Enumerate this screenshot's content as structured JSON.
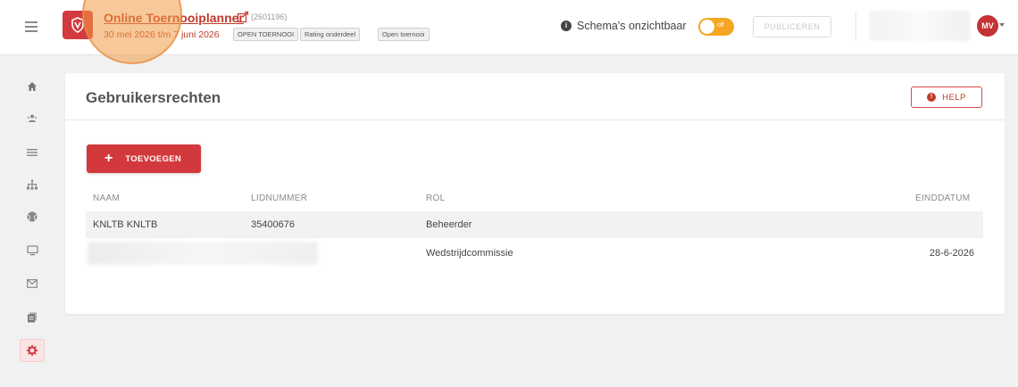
{
  "header": {
    "title": "Online Toernooiplanner",
    "tournament_id": "(2601196)",
    "dates": "30 mei 2026 t/m 7 juni 2026",
    "badges": [
      "OPEN TOERNOOI",
      "Rating onderdeel",
      "Open toernooi"
    ],
    "schema_label": "Schema's onzichtbaar",
    "toggle_text": "off",
    "publish_label": "PUBLICEREN",
    "avatar_initials": "MV"
  },
  "sidebar": {
    "items": [
      {
        "icon": "home-icon"
      },
      {
        "icon": "users-icon"
      },
      {
        "icon": "list-icon"
      },
      {
        "icon": "hierarchy-icon"
      },
      {
        "icon": "ball-icon"
      },
      {
        "icon": "monitor-icon"
      },
      {
        "icon": "mail-icon"
      },
      {
        "icon": "documents-icon"
      },
      {
        "icon": "gear-icon",
        "active": true
      }
    ]
  },
  "main": {
    "title": "Gebruikersrechten",
    "help_label": "HELP",
    "add_label": "TOEVOEGEN",
    "columns": [
      "NAAM",
      "LIDNUMMER",
      "ROL",
      "EINDDATUM"
    ],
    "rows": [
      {
        "naam": "KNLTB KNLTB",
        "lidnummer": "35400676",
        "rol": "Beheerder",
        "einddatum": ""
      },
      {
        "naam": "",
        "lidnummer": "",
        "rol": "Wedstrijdcommissie",
        "einddatum": "28-6-2026"
      }
    ]
  },
  "colors": {
    "accent": "#d3393c",
    "toggle": "#f5a623",
    "highlight": "#f09a46"
  }
}
